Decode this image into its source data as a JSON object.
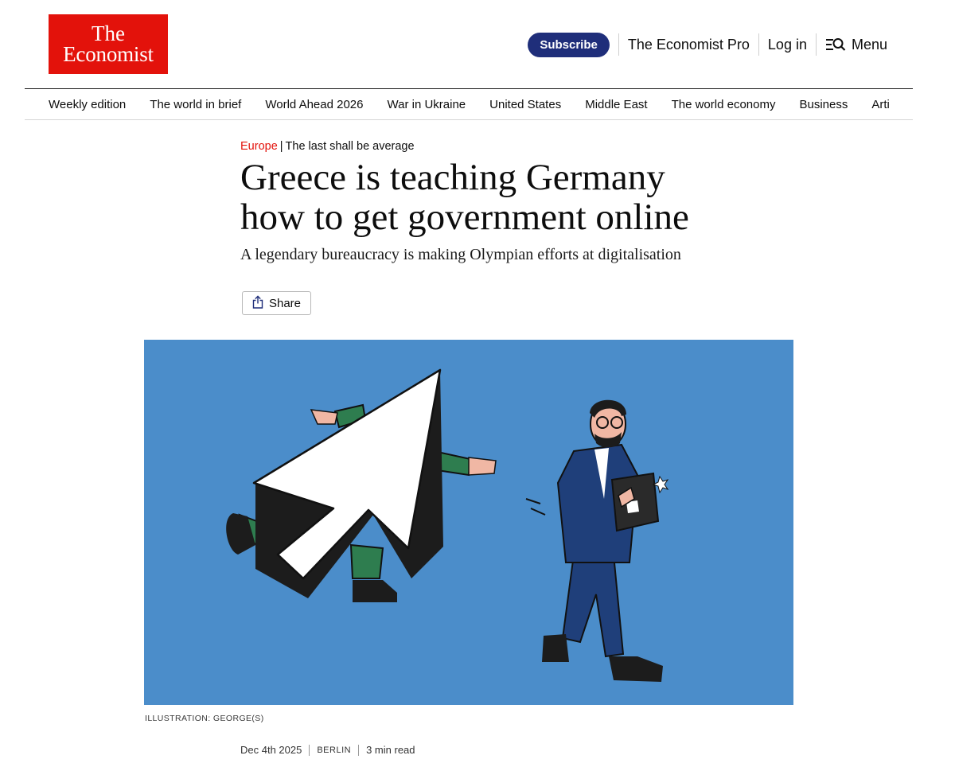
{
  "header": {
    "logo_line1": "The",
    "logo_line2": "Economist",
    "subscribe": "Subscribe",
    "pro": "The Economist Pro",
    "login": "Log in",
    "menu": "Menu"
  },
  "nav": {
    "items": [
      "Weekly edition",
      "The world in brief",
      "World Ahead 2026",
      "War in Ukraine",
      "United States",
      "Middle East",
      "The world economy",
      "Business",
      "Artificial intel"
    ]
  },
  "article": {
    "section": "Europe",
    "separator": "|",
    "rubric": "The last shall be average",
    "headline_line1": "Greece is teaching Germany",
    "headline_line2": "how to get government online",
    "standfirst": "A legendary bureaucracy is making Olympian efforts at digitalisation",
    "share": "Share",
    "image_credit": "ILLUSTRATION: GEORGE(S)",
    "date": "Dec 4th 2025",
    "dateline": "BERLIN",
    "read_time": "3 min read"
  },
  "icons": {
    "share": "share-icon",
    "menu": "search-menu-icon"
  },
  "colors": {
    "brand_red": "#e3120b",
    "subscribe_blue": "#1f2e7a",
    "illustration_bg": "#4b8dca"
  }
}
